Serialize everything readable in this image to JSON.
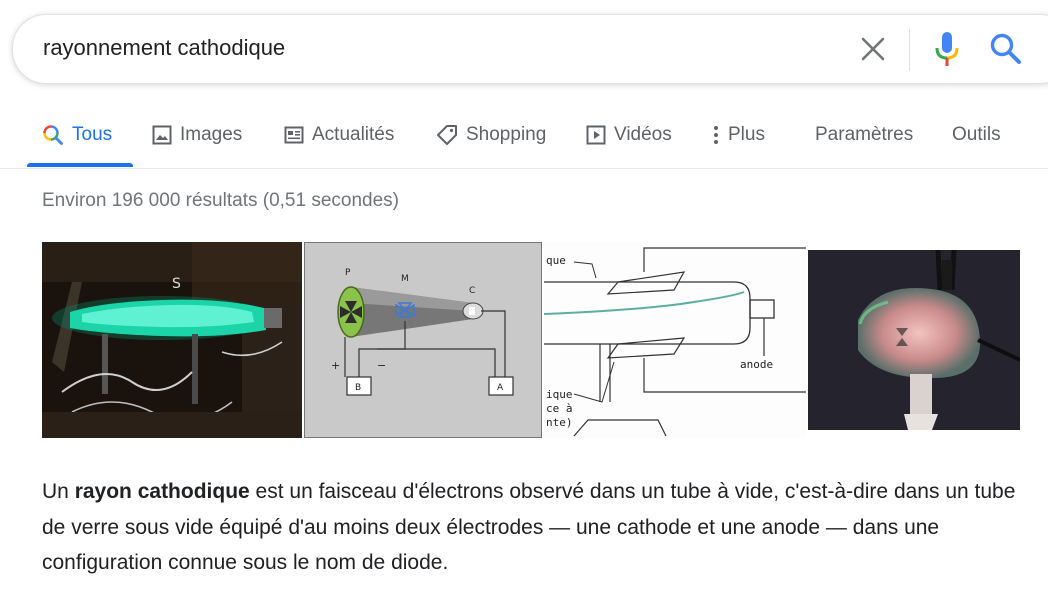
{
  "search": {
    "query": "rayonnement cathodique"
  },
  "tabs": [
    {
      "label": "Tous",
      "icon": "search-icon",
      "active": true
    },
    {
      "label": "Images",
      "icon": "image-icon"
    },
    {
      "label": "Actualités",
      "icon": "news-icon"
    },
    {
      "label": "Shopping",
      "icon": "tag-icon"
    },
    {
      "label": "Vidéos",
      "icon": "video-icon"
    },
    {
      "label": "Plus",
      "icon": "more-vert-icon"
    },
    {
      "label": "Paramètres"
    },
    {
      "label": "Outils"
    }
  ],
  "stats": "Environ 196 000 résultats (0,51 secondes)",
  "images": {
    "diagram1_labels": [
      "P",
      "M",
      "C",
      "+",
      "−",
      "B",
      "A"
    ],
    "diagram2_labels": [
      "que",
      "anode",
      "ique",
      "ce à",
      "nte)"
    ]
  },
  "snippet": {
    "before": "Un ",
    "bold": "rayon cathodique",
    "after": " est un faisceau d'électrons observé dans un tube à vide, c'est-à-dire dans un tube de verre sous vide équipé d'au moins deux électrodes — une cathode et une anode — dans une configuration connue sous le nom de diode."
  },
  "colors": {
    "accent": "#1a73e8",
    "tab_text": "#5f6368",
    "stats_text": "#70757a",
    "google_blue": "#4285f4",
    "google_red": "#ea4335",
    "google_yellow": "#fbbc04",
    "google_green": "#34a853"
  }
}
